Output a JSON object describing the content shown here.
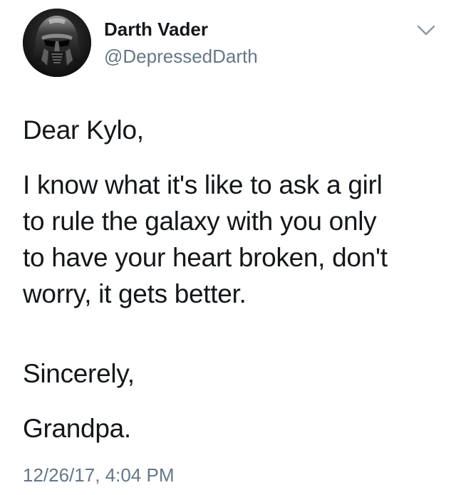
{
  "author": {
    "name": "Darth Vader",
    "handle": "@DepressedDarth",
    "avatar_icon": "darth-vader-helmet-icon"
  },
  "menu": {
    "icon": "chevron-down-icon"
  },
  "tweet": {
    "greeting": "Dear Kylo,",
    "body_lines": [
      "I know what it's like to ask a girl",
      "to rule the galaxy with you only",
      "to have your heart broken, don't",
      "worry, it gets better."
    ],
    "closing": "Sincerely,",
    "signature": "Grandpa.",
    "timestamp": "12/26/17, 4:04 PM"
  },
  "colors": {
    "text": "#14171a",
    "secondary": "#657786",
    "background": "#ffffff"
  }
}
